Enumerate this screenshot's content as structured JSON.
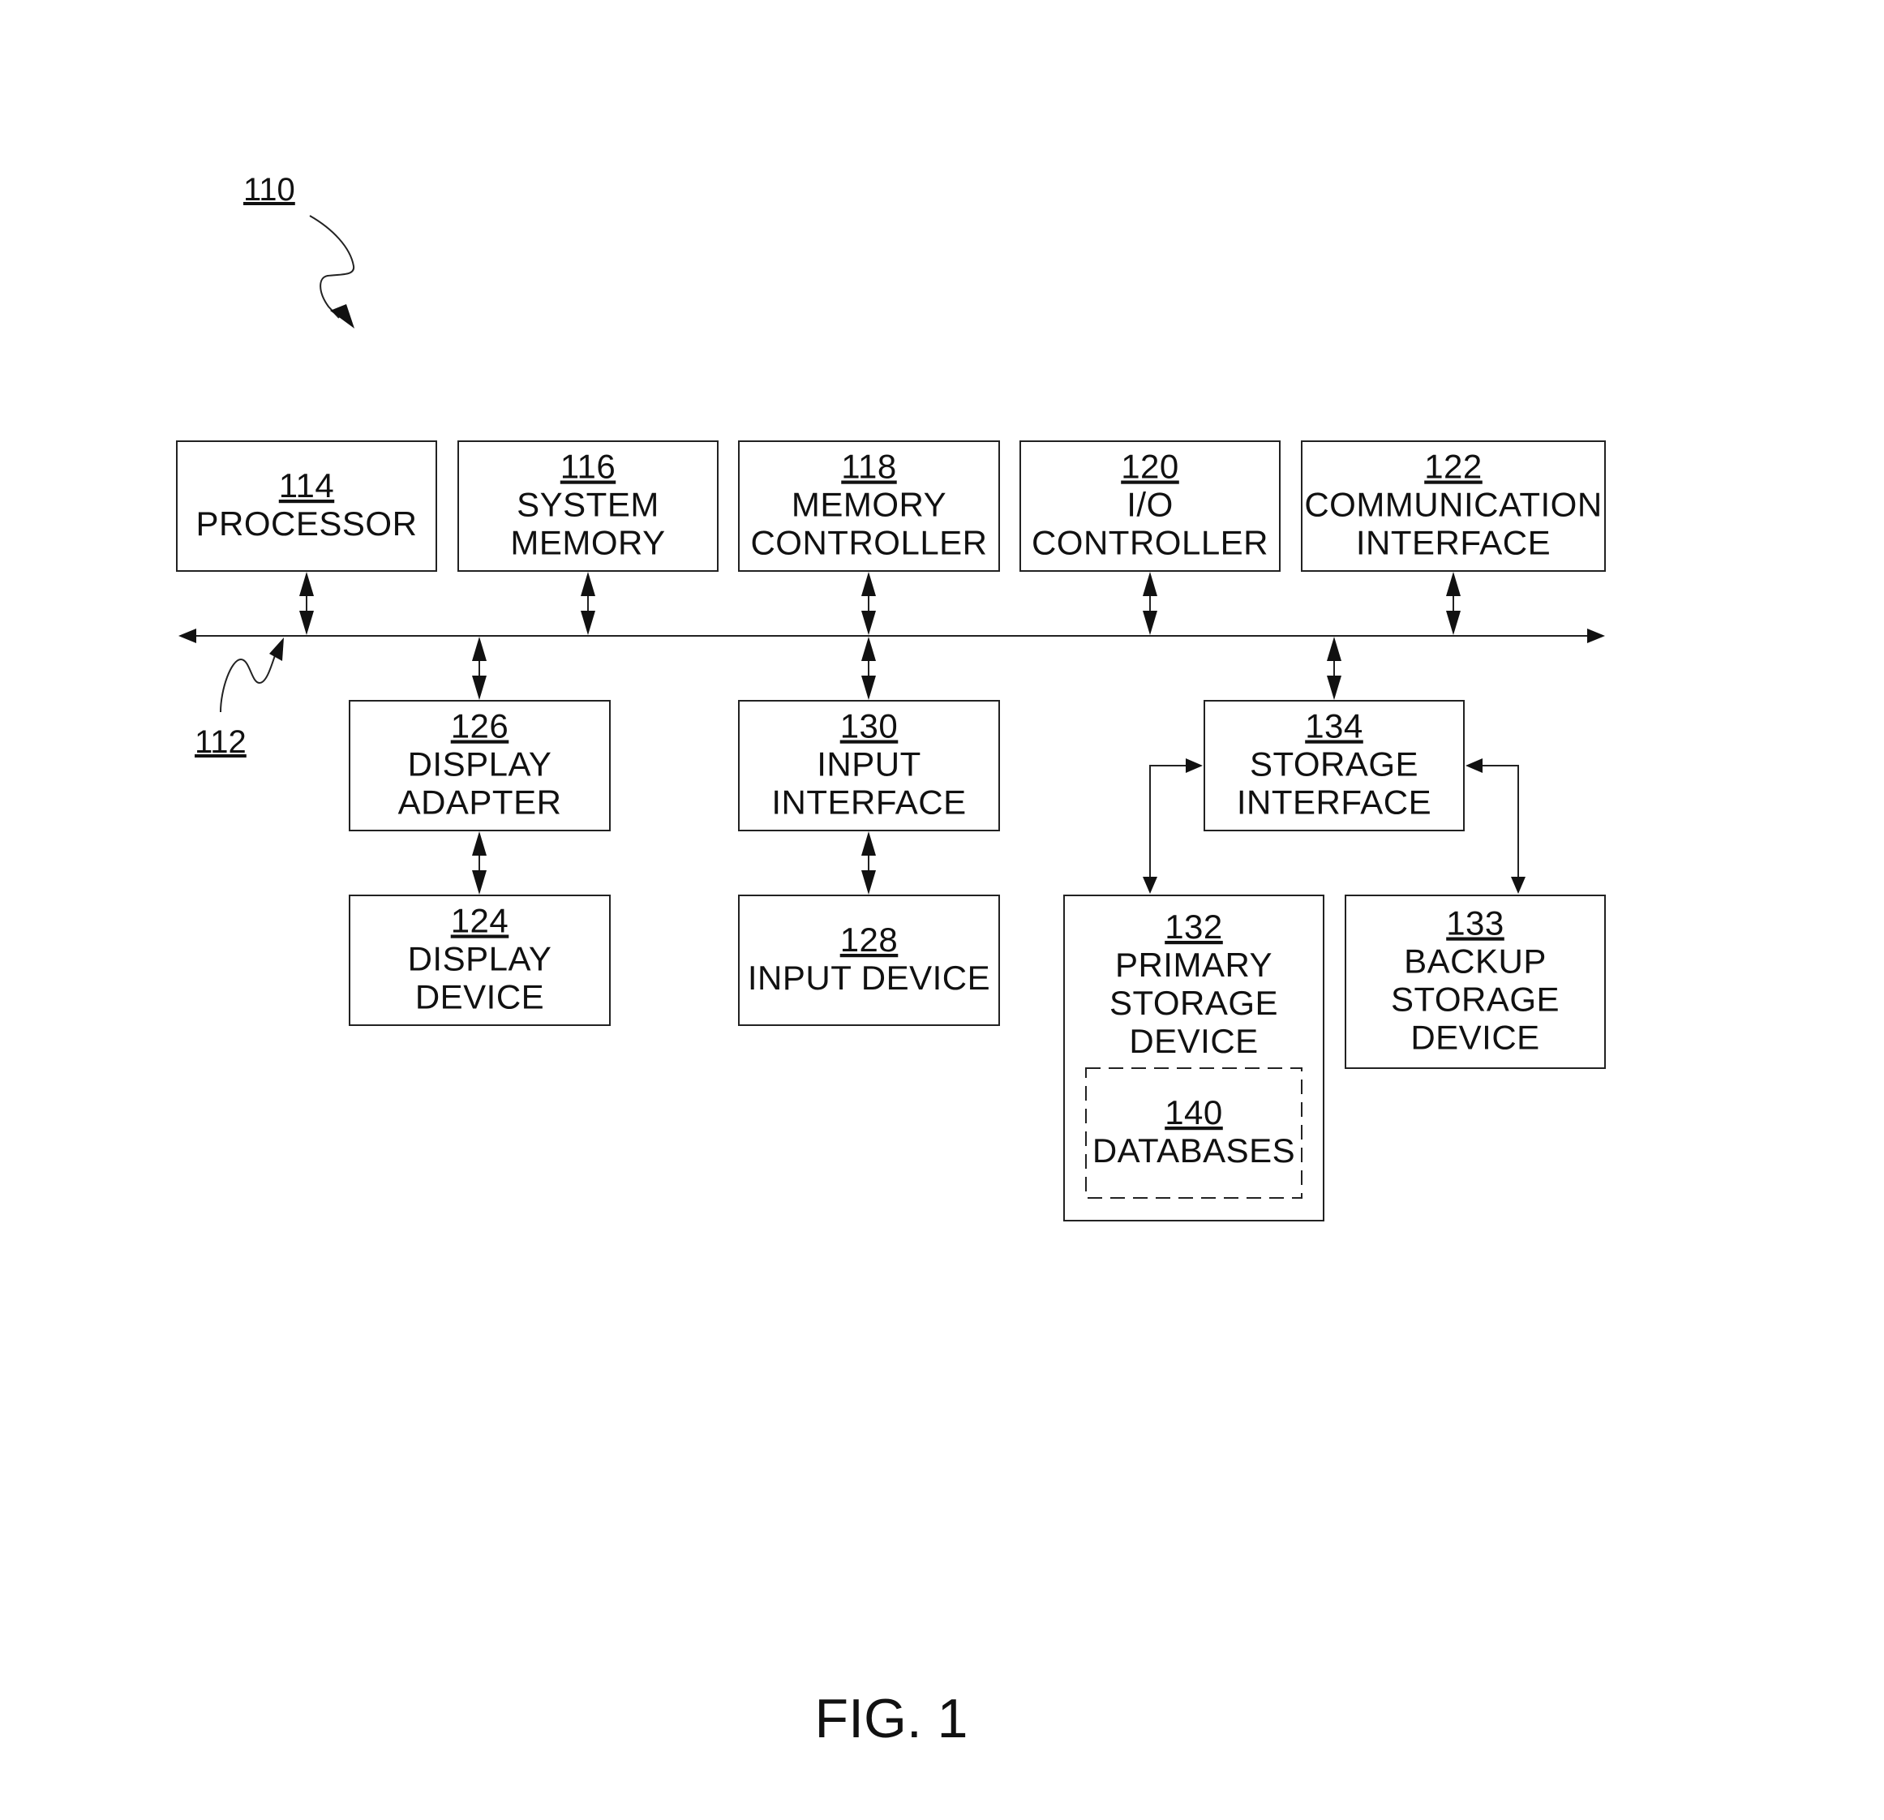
{
  "figure": {
    "caption": "FIG. 1",
    "system_ref": "110",
    "bus_ref": "112"
  },
  "blocks": {
    "processor": {
      "ref": "114",
      "lines": [
        "PROCESSOR"
      ]
    },
    "system_memory": {
      "ref": "116",
      "lines": [
        "SYSTEM",
        "MEMORY"
      ]
    },
    "memory_controller": {
      "ref": "118",
      "lines": [
        "MEMORY",
        "CONTROLLER"
      ]
    },
    "io_controller": {
      "ref": "120",
      "lines": [
        "I/O",
        "CONTROLLER"
      ]
    },
    "communication_interface": {
      "ref": "122",
      "lines": [
        "COMMUNICATION",
        "INTERFACE"
      ]
    },
    "display_adapter": {
      "ref": "126",
      "lines": [
        "DISPLAY",
        "ADAPTER"
      ]
    },
    "input_interface": {
      "ref": "130",
      "lines": [
        "INPUT",
        "INTERFACE"
      ]
    },
    "storage_interface": {
      "ref": "134",
      "lines": [
        "STORAGE",
        "INTERFACE"
      ]
    },
    "display_device": {
      "ref": "124",
      "lines": [
        "DISPLAY",
        "DEVICE"
      ]
    },
    "input_device": {
      "ref": "128",
      "lines": [
        "INPUT DEVICE"
      ]
    },
    "primary_storage_device": {
      "ref": "132",
      "lines": [
        "PRIMARY",
        "STORAGE",
        "DEVICE"
      ]
    },
    "backup_storage_device": {
      "ref": "133",
      "lines": [
        "BACKUP",
        "STORAGE",
        "DEVICE"
      ]
    },
    "databases": {
      "ref": "140",
      "lines": [
        "DATABASES"
      ]
    }
  },
  "connections": [
    {
      "from": "processor",
      "to": "bus",
      "type": "bidirectional"
    },
    {
      "from": "system_memory",
      "to": "bus",
      "type": "bidirectional"
    },
    {
      "from": "memory_controller",
      "to": "bus",
      "type": "bidirectional"
    },
    {
      "from": "io_controller",
      "to": "bus",
      "type": "bidirectional"
    },
    {
      "from": "communication_interface",
      "to": "bus",
      "type": "bidirectional"
    },
    {
      "from": "bus",
      "to": "display_adapter",
      "type": "bidirectional"
    },
    {
      "from": "bus",
      "to": "input_interface",
      "type": "bidirectional"
    },
    {
      "from": "bus",
      "to": "storage_interface",
      "type": "bidirectional"
    },
    {
      "from": "display_adapter",
      "to": "display_device",
      "type": "bidirectional"
    },
    {
      "from": "input_interface",
      "to": "input_device",
      "type": "bidirectional"
    },
    {
      "from": "storage_interface",
      "to": "primary_storage_device",
      "type": "bidirectional"
    },
    {
      "from": "storage_interface",
      "to": "backup_storage_device",
      "type": "bidirectional"
    }
  ]
}
